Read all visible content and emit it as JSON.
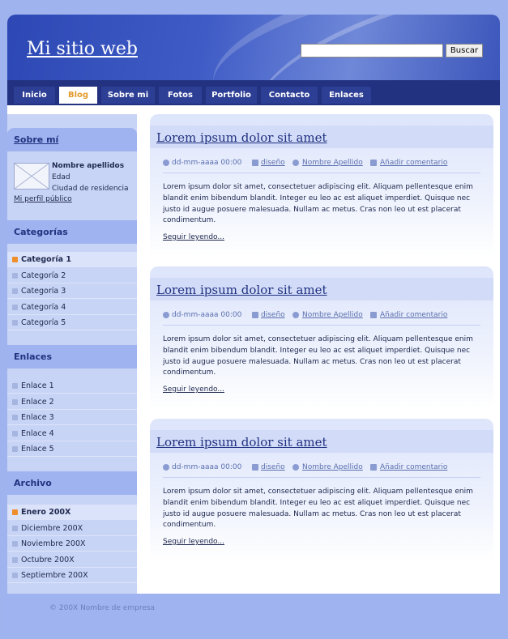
{
  "header": {
    "site_title": "Mi sitio web",
    "search_placeholder": "",
    "search_button": "Buscar"
  },
  "nav": {
    "items": [
      {
        "label": "Inicio",
        "active": false
      },
      {
        "label": "Blog",
        "active": true
      },
      {
        "label": "Sobre mi",
        "active": false
      },
      {
        "label": "Fotos",
        "active": false
      },
      {
        "label": "Portfolio",
        "active": false
      },
      {
        "label": "Contacto",
        "active": false
      },
      {
        "label": "Enlaces",
        "active": false
      }
    ]
  },
  "sidebar": {
    "about": {
      "heading": "Sobre mí",
      "name": "Nombre apellidos",
      "age": "Edad",
      "city": "Ciudad de residencia",
      "profile_link": "Mi perfil público"
    },
    "categories": {
      "heading": "Categorías",
      "items": [
        "Categoría 1",
        "Categoría 2",
        "Categoría 3",
        "Categoría 4",
        "Categoría 5"
      ]
    },
    "links": {
      "heading": "Enlaces",
      "items": [
        "Enlace 1",
        "Enlace 2",
        "Enlace 3",
        "Enlace 4",
        "Enlace 5"
      ]
    },
    "archive": {
      "heading": "Archivo",
      "items": [
        "Enero 200X",
        "Diciembre 200X",
        "Noviembre 200X",
        "Octubre 200X",
        "Septiembre 200X"
      ]
    }
  },
  "posts": [
    {
      "title": "Lorem ipsum dolor sit amet",
      "date": "dd-mm-aaaa 00:00",
      "category": "diseño",
      "author": "Nombre Apellido",
      "comment": "Añadir comentario",
      "body": "Lorem ipsum dolor sit amet, consectetuer adipiscing elit. Aliquam pellentesque enim blandit enim bibendum blandit. Integer eu leo ac est aliquet imperdiet. Quisque nec justo id augue posuere malesuada. Nullam ac metus. Cras non leo ut est placerat condimentum.",
      "read_more": "Seguir leyendo..."
    },
    {
      "title": "Lorem ipsum dolor sit amet",
      "date": "dd-mm-aaaa 00:00",
      "category": "diseño",
      "author": "Nombre Apellido",
      "comment": "Añadir comentario",
      "body": "Lorem ipsum dolor sit amet, consectetuer adipiscing elit. Aliquam pellentesque enim blandit enim bibendum blandit. Integer eu leo ac est aliquet imperdiet. Quisque nec justo id augue posuere malesuada. Nullam ac metus. Cras non leo ut est placerat condimentum.",
      "read_more": "Seguir leyendo..."
    },
    {
      "title": "Lorem ipsum dolor sit amet",
      "date": "dd-mm-aaaa 00:00",
      "category": "diseño",
      "author": "Nombre Apellido",
      "comment": "Añadir comentario",
      "body": "Lorem ipsum dolor sit amet, consectetuer adipiscing elit. Aliquam pellentesque enim blandit enim bibendum blandit. Integer eu leo ac est aliquet imperdiet. Quisque nec justo id augue posuere malesuada. Nullam ac metus. Cras non leo ut est placerat condimentum.",
      "read_more": "Seguir leyendo..."
    }
  ],
  "footer": {
    "copyright": "© 200X Nombre de empresa"
  },
  "colors": {
    "page_bg": "#9fb3ef",
    "header_blue": "#3f5cc6",
    "nav_dark": "#223280",
    "nav_active_text": "#e39a2c",
    "sidebar_bg": "#c8d4f6",
    "bullet_active": "#ef8f2c"
  }
}
